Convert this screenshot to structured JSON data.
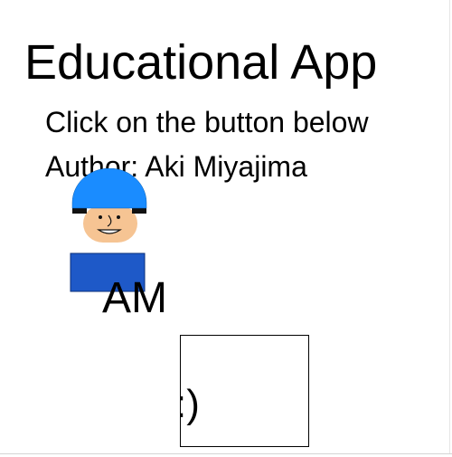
{
  "app": {
    "title": "Educational App",
    "instruction": "Click on the button below",
    "author": "Author: Aki Miyajima",
    "initials": "AM"
  },
  "button": {
    "label": ":)"
  },
  "avatar": {
    "icon": "cartoon-person-blue-cap-icon",
    "colors": {
      "cap": "#1a8cff",
      "skin": "#f6c493",
      "shirt": "#1e59c8",
      "hair": "#111111"
    }
  }
}
